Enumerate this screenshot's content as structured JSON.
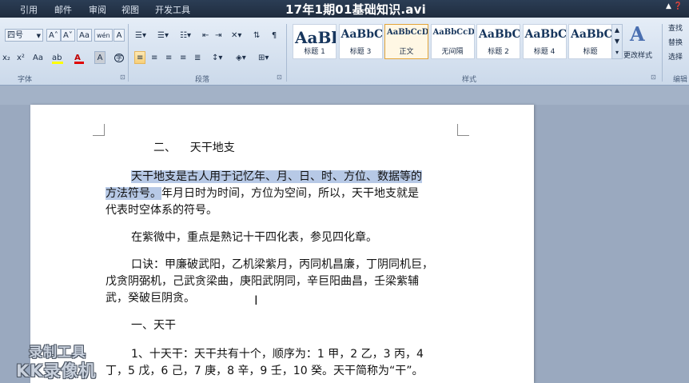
{
  "window": {
    "title": "17年1期01基础知识.avi",
    "tabs": [
      "引用",
      "邮件",
      "审阅",
      "视图",
      "开发工具"
    ]
  },
  "ribbon": {
    "font_group": {
      "label": "字体",
      "font_size": "四号",
      "grow_font": "A˄",
      "shrink_font": "A˅",
      "clear_format": "Aa",
      "phonetic": "wén",
      "char_border": "A",
      "subscript": "x₂",
      "superscript": "x²",
      "change_case": "Aa",
      "highlight": "ab",
      "font_color": "A",
      "char_shading": "A",
      "enclose": "字"
    },
    "paragraph_group": {
      "label": "段落"
    },
    "styles_group": {
      "label": "样式",
      "tiles": [
        {
          "sample": "AaBl",
          "name": "标题 1",
          "size": 20,
          "selected": false
        },
        {
          "sample": "AaBbC",
          "name": "标题 3",
          "size": 14,
          "selected": false
        },
        {
          "sample": "AaBbCcDc",
          "name": "正文",
          "size": 10,
          "selected": true
        },
        {
          "sample": "AaBbCcDc",
          "name": "无间隔",
          "size": 10,
          "selected": false
        },
        {
          "sample": "AaBbC",
          "name": "标题 2",
          "size": 14,
          "selected": false
        },
        {
          "sample": "AaBbC",
          "name": "标题 4",
          "size": 14,
          "selected": false
        },
        {
          "sample": "AaBbC",
          "name": "标题",
          "size": 14,
          "selected": false
        }
      ],
      "change_styles": "更改样式"
    },
    "editing_group": {
      "label": "编辑",
      "items": [
        "查找",
        "替换",
        "选择"
      ]
    }
  },
  "document": {
    "heading2": "二、    天干地支",
    "para1_highlight_line1": "天干地支是古人用于记忆年、月、日、时、方位、数据等的",
    "para1_highlight_line2": "方法符号。",
    "para1_rest_line2": "年月日时为时间，方位为空间，所以，天干地支就是",
    "para1_line3": "代表时空体系的符号。",
    "para2": "在紫微中，重点是熟记十干四化表，参见四化章。",
    "para3_line1": "口诀：甲廉破武阳，乙机梁紫月，丙同机昌廉，丁阴同机巨，",
    "para3_line2": "戊贪阴弼机，己武贪梁曲，庚阳武阴同，辛巨阳曲昌，壬梁紫辅",
    "para3_line3": "武，癸破巨阴贪。",
    "section1": "一、天干",
    "para4_line1": "1、十天干：天干共有十个，顺序为：1 甲，2 乙，3 丙，4",
    "para4_line2": "丁，5 戊，6 己，7 庚，8 辛，9 壬，10 癸。天干简称为“干”。"
  },
  "watermark": {
    "line1": "录制工具",
    "line2": "KK录像机"
  }
}
